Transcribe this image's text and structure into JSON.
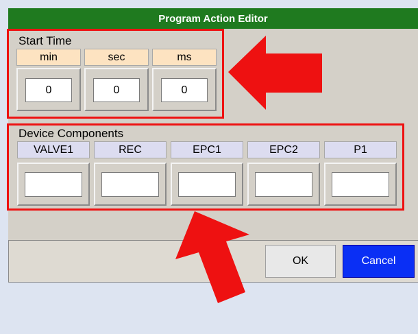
{
  "dialog": {
    "title": "Program Action Editor"
  },
  "start_time": {
    "label": "Start Time",
    "columns": [
      {
        "header": "min",
        "value": "0"
      },
      {
        "header": "sec",
        "value": "0"
      },
      {
        "header": "ms",
        "value": "0"
      }
    ]
  },
  "device_components": {
    "label": "Device Components",
    "columns": [
      {
        "header": "VALVE1",
        "value": ""
      },
      {
        "header": "REC",
        "value": ""
      },
      {
        "header": "EPC1",
        "value": ""
      },
      {
        "header": "EPC2",
        "value": ""
      },
      {
        "header": "P1",
        "value": ""
      }
    ]
  },
  "buttons": {
    "ok_label": "OK",
    "cancel_label": "Cancel"
  },
  "colors": {
    "title_bar": "#1f7a1f",
    "time_header": "#fde3c1",
    "device_header": "#dcdcf0",
    "cancel_button": "#0a2ff5",
    "annotation": "#ee1111"
  },
  "icons": [
    "arrow-left-annotation",
    "arrow-up-annotation"
  ]
}
